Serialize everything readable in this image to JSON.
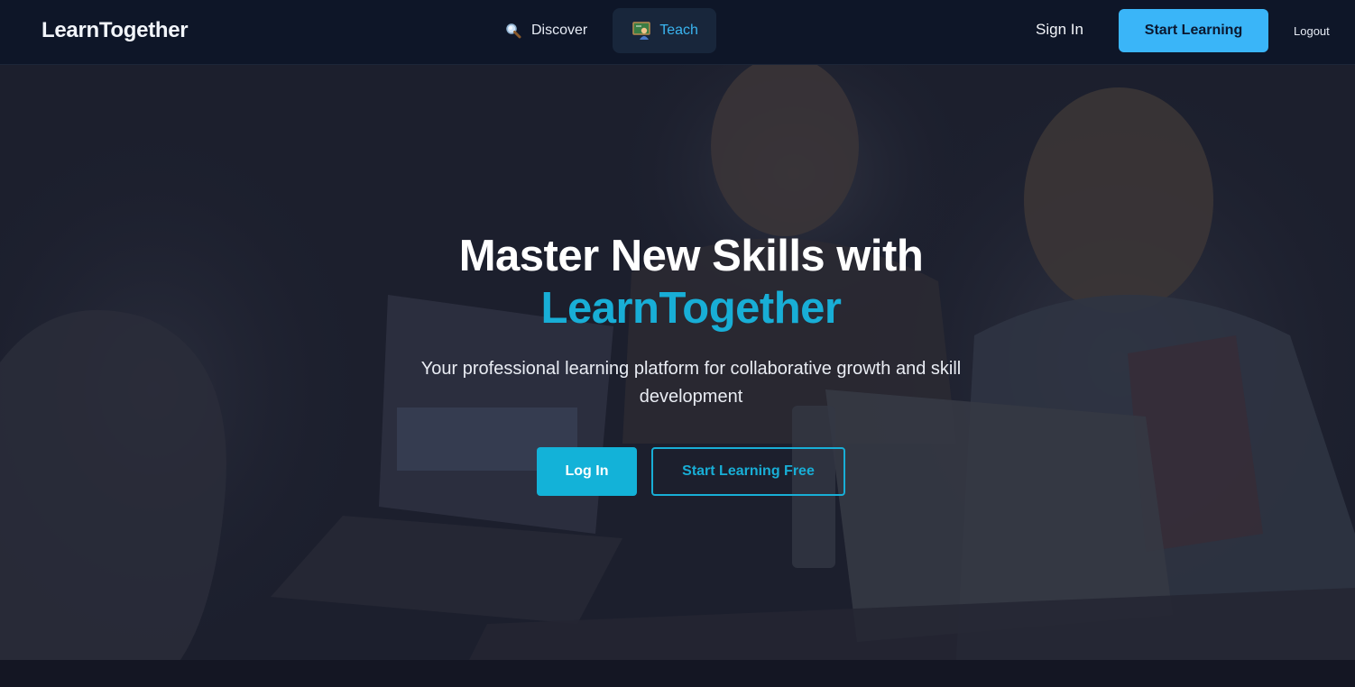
{
  "nav": {
    "brand": "LearnTogether",
    "links": [
      {
        "label": "Discover",
        "icon": "search-icon",
        "active": false
      },
      {
        "label": "Teach",
        "icon": "teacher-icon",
        "active": true
      }
    ],
    "sign_in": "Sign In",
    "start_learning": "Start Learning",
    "logout": "Logout"
  },
  "hero": {
    "title_line1": "Master New Skills with",
    "title_accent": "LearnTogether",
    "subtitle": "Your professional learning platform for collaborative growth and skill development",
    "login_button": "Log In",
    "free_button": "Start Learning Free"
  },
  "colors": {
    "nav_bg": "#0e1628",
    "accent": "#18aed6",
    "primary_button": "#3ab5f8",
    "hero_overlay": "#1b1f2c"
  }
}
